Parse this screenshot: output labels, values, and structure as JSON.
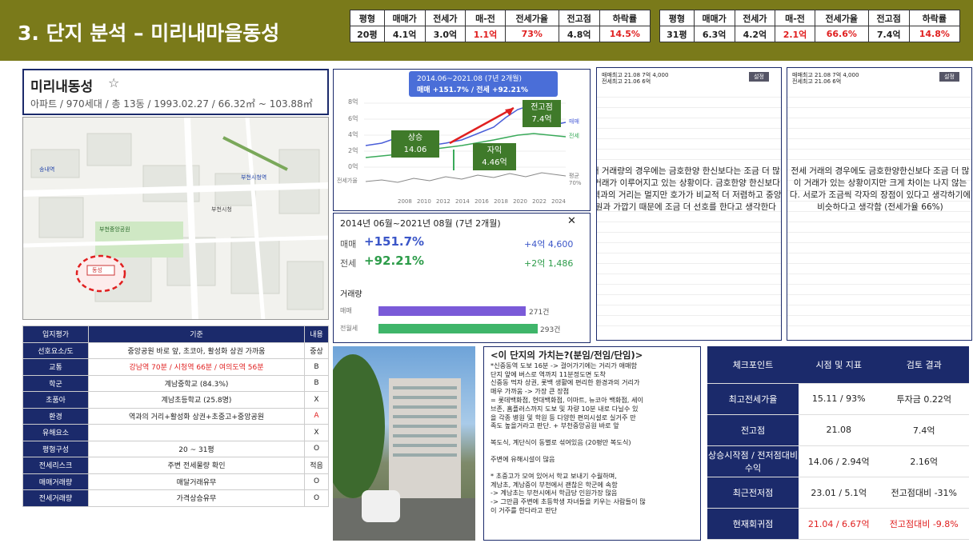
{
  "header": {
    "title": "3. 단지 분석 – 미리내마을동성"
  },
  "price_tables": [
    {
      "headers": [
        "평형",
        "매매가",
        "전세가",
        "매-전",
        "전세가율",
        "전고점",
        "하락률"
      ],
      "row": [
        "20평",
        "4.1억",
        "3.0억",
        "1.1억",
        "73%",
        "4.8억",
        "14.5%"
      ]
    },
    {
      "headers": [
        "평형",
        "매매가",
        "전세가",
        "매-전",
        "전세가율",
        "전고점",
        "하락률"
      ],
      "row": [
        "31평",
        "6.3억",
        "4.2억",
        "2.1억",
        "66.6%",
        "7.4억",
        "14.8%"
      ]
    }
  ],
  "complex": {
    "name": "미리내동성",
    "star": "☆",
    "summary": "아파트 / 970세대 / 총 13동 / 1993.02.27 / 66.32㎡ ~ 103.88㎡"
  },
  "map": {
    "labels": [
      "부천중앙공원",
      "부천시청역",
      "부천시청",
      "송내역",
      "동성"
    ]
  },
  "location_eval": {
    "headers": [
      "입지평가",
      "기준",
      "내용"
    ],
    "rows": [
      [
        "선호요소/도",
        "중앙공원 바로 앞, 초코아, 활성화 상권 가까움",
        "중상"
      ],
      [
        "교통",
        "강남역 70분 / 시청역 66분 / 여의도역 56분",
        "B"
      ],
      [
        "학군",
        "계남중학교 (84.3%)",
        "B"
      ],
      [
        "초품아",
        "계남초등학교 (25.8명)",
        "X"
      ],
      [
        "환경",
        "역과의 거리+활성화 상권+초중고+중앙공원",
        "A"
      ],
      [
        "유해요소",
        "",
        "X"
      ],
      [
        "평형구성",
        "20 ~ 31평",
        "O"
      ],
      [
        "전세리스크",
        "주변 전세물량 확인",
        "적음"
      ],
      [
        "매매거래량",
        "매달거래유무",
        "O"
      ],
      [
        "전세거래량",
        "가격상승유무",
        "O"
      ]
    ]
  },
  "chart_top": {
    "banner": "2014.06~2021.08 (7년 2개월)",
    "banner2": "매매 +151.7% / 전세 +92.21%",
    "label_rise": "상승",
    "label_rise_date": "14.06",
    "label_cap": "자익",
    "label_cap_val": "4.46억",
    "label_peak": "전고점",
    "label_peak_val": "7.4억",
    "y_labels": [
      "8억",
      "6억",
      "4억",
      "2억",
      "0억"
    ],
    "side_labels": [
      "매매",
      "전세"
    ],
    "jeonse_rate": "전세가율",
    "rate_side": "평균",
    "rate_val": "70%",
    "x_labels": [
      "2008",
      "2010",
      "2012",
      "2014",
      "2016",
      "2018",
      "2020",
      "2022",
      "2024"
    ]
  },
  "chart_bottom": {
    "title": "2014년 06월~2021년 08월 (7년 2개월)",
    "close": "✕",
    "sale_label": "매매",
    "sale_pct": "+151.7%",
    "sale_amt": "+4억 4,600",
    "jeonse_label": "전세",
    "jeonse_pct": "+92.21%",
    "jeonse_amt": "+2억 1,486",
    "volume_title": "거래량",
    "vol_sale_label": "매매",
    "vol_sale": "271건",
    "vol_jeonse_label": "전월세",
    "vol_jeonse": "293건"
  },
  "trade_left": {
    "head1": "매매최고 21.08 7억 4,000",
    "head2": "전세최고 21.06 6억",
    "btn": "설정",
    "overlay": "매매 거래량의 경우에는 금호한양 한신보다는 조금 더 많이 거래가 이루어지고 있는 상황이다. 금호한양 한신보다는 역과의 거리는 멀지만 호가가 비교적 더 저렴하고 중앙공원과 가깝기 때문에 조금 더 선호를 한다고 생각한다"
  },
  "trade_right": {
    "head1": "매매최고 21.08 7억 4,000",
    "head2": "전세최고 21.06 6억",
    "btn": "설정",
    "overlay": "전세 거래의 경우에도 금호한양한신보다 조금 더 많이 거래가 있는 상황이지만 크게 차이는 나지 않는다. 서로가 조금씩 각자의 장점이 있다고 생각하기에 비슷하다고 생각함 (전세가율 66%)"
  },
  "value": {
    "title": "<이 단지의 가치는?(분임/전임/단임)>",
    "body": [
      "*신중동역 도보 16분 -> 걸어가기에는 거리가 애매함",
      "단지 앞에 버스로 역까지 11분정도면 도착",
      "신중동 먹자 상권, 롯백 생활에 편리한 환경과의 거리가",
      "매우 가까움 -> 가장 큰 장점",
      "= 롯데백화점, 현대백화점, 이마트, 뉴코아 백화점, 세이",
      "브존, 홈플러스까지 도보 및 차량 10분 내로 다닐수 있",
      "을 각종 병원 및 학원 등 다양한 편의시설로 실거주 만",
      "족도 높을거라고 판단. + 부천중앙공원 바로 앞",
      "",
      "복도식, 계단식이 동별로 섞여있음 (20평만 복도식)",
      "",
      "주변에 유해시설이 많음",
      "",
      "* 초중고가 모여 있어서 학교 보내기 수월하며,",
      "계남초, 계남중이 부천에서 괜찮은 학군에 속함",
      "-> 계남초는 부천시에서 학급당 인원가장 많음",
      "-> 그만큼 주변에 초등학생 자녀들을 키우는 사람들이 많",
      "이 거주를 한다라고 판단"
    ]
  },
  "checkpoint": {
    "headers": [
      "체크포인트",
      "시점 및 지표",
      "검토 결과"
    ],
    "rows": [
      [
        "최고전세가율",
        "15.11 / 93%",
        "투자금 0.22억"
      ],
      [
        "전고점",
        "21.08",
        "7.4억"
      ],
      [
        "상승시작점 / 전저점대비 수익",
        "14.06 / 2.94억",
        "2.16억"
      ],
      [
        "최근전저점",
        "23.01 / 5.1억",
        "전고점대비 -31%"
      ],
      [
        "현재회귀점",
        "21.04 / 6.67억",
        "전고점대비 -9.8%"
      ]
    ]
  }
}
